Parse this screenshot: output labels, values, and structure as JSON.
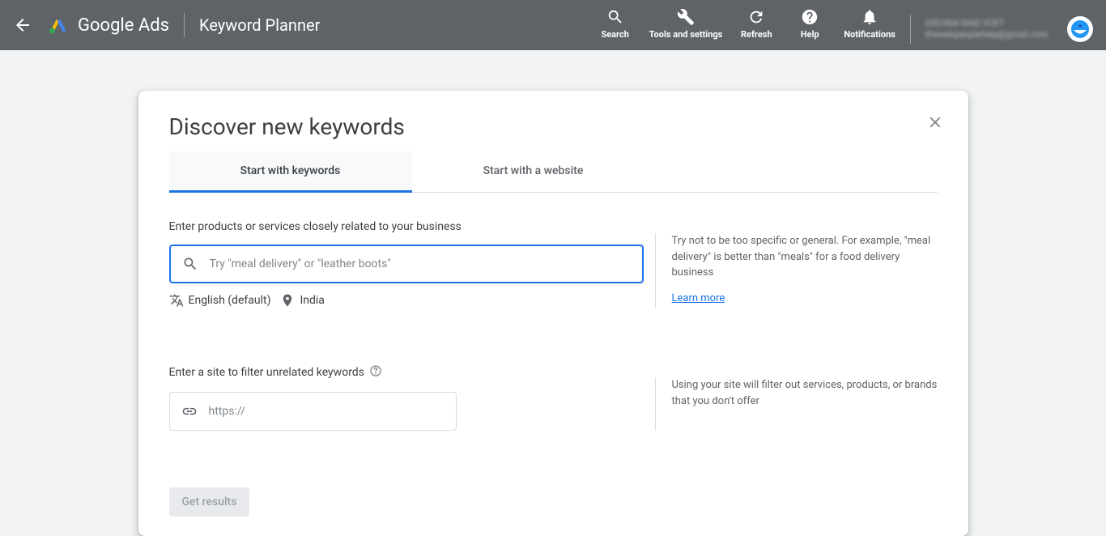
{
  "header": {
    "brand": "Google Ads",
    "page_title": "Keyword Planner",
    "actions": {
      "search": "Search",
      "tools": "Tools and settings",
      "refresh": "Refresh",
      "help": "Help",
      "notifications": "Notifications"
    },
    "account_line1": "655-064-5442 VCET",
    "account_line2": "thewebpeoplehelp@gmail.com"
  },
  "card": {
    "title": "Discover new keywords",
    "tabs": {
      "keywords": "Start with keywords",
      "website": "Start with a website"
    },
    "keyword_section": {
      "label": "Enter products or services closely related to your business",
      "placeholder": "Try \"meal delivery\" or \"leather boots\"",
      "language": "English (default)",
      "location": "India",
      "tip": "Try not to be too specific or general. For example, \"meal delivery\" is better than \"meals\" for a food delivery business",
      "learn_more": "Learn more"
    },
    "site_section": {
      "label": "Enter a site to filter unrelated keywords",
      "placeholder": "https://",
      "tip": "Using your site will filter out services, products, or brands that you don't offer"
    },
    "results_btn": "Get results"
  }
}
